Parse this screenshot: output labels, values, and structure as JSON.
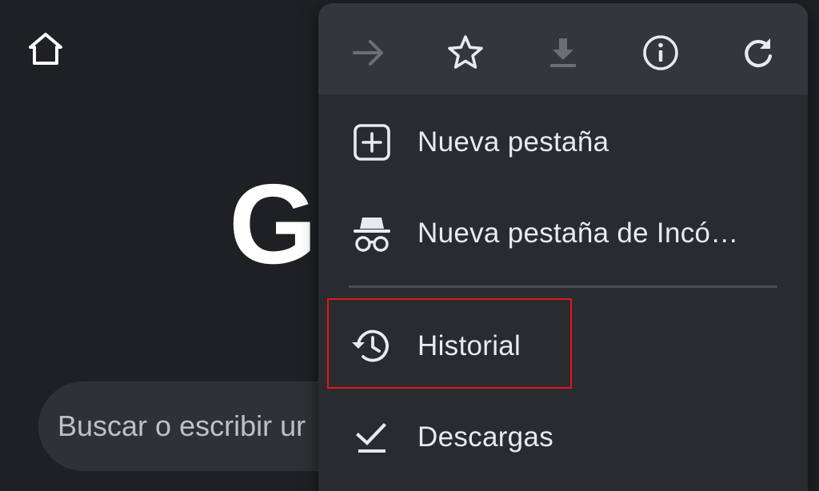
{
  "background_page": {
    "logo_text": "G",
    "search_placeholder": "Buscar o escribir ur"
  },
  "menu": {
    "toolbar": [
      {
        "icon": "forward-arrow-icon",
        "state": "disabled"
      },
      {
        "icon": "star-icon",
        "state": "enabled"
      },
      {
        "icon": "download-icon",
        "state": "disabled"
      },
      {
        "icon": "info-icon",
        "state": "enabled"
      },
      {
        "icon": "refresh-icon",
        "state": "enabled"
      }
    ],
    "items": [
      {
        "label": "Nueva pestaña",
        "icon": "new-tab-icon"
      },
      {
        "label": "Nueva pestaña de Incó…",
        "icon": "incognito-icon"
      },
      {
        "label": "Historial",
        "icon": "history-icon"
      },
      {
        "label": "Descargas",
        "icon": "downloads-check-icon"
      }
    ]
  },
  "colors": {
    "page_background": "#1f2023",
    "menu_background": "#292b2e",
    "toolbar_background": "#33373c",
    "highlight_border": "#e8131e",
    "text": "#e8eaed"
  }
}
